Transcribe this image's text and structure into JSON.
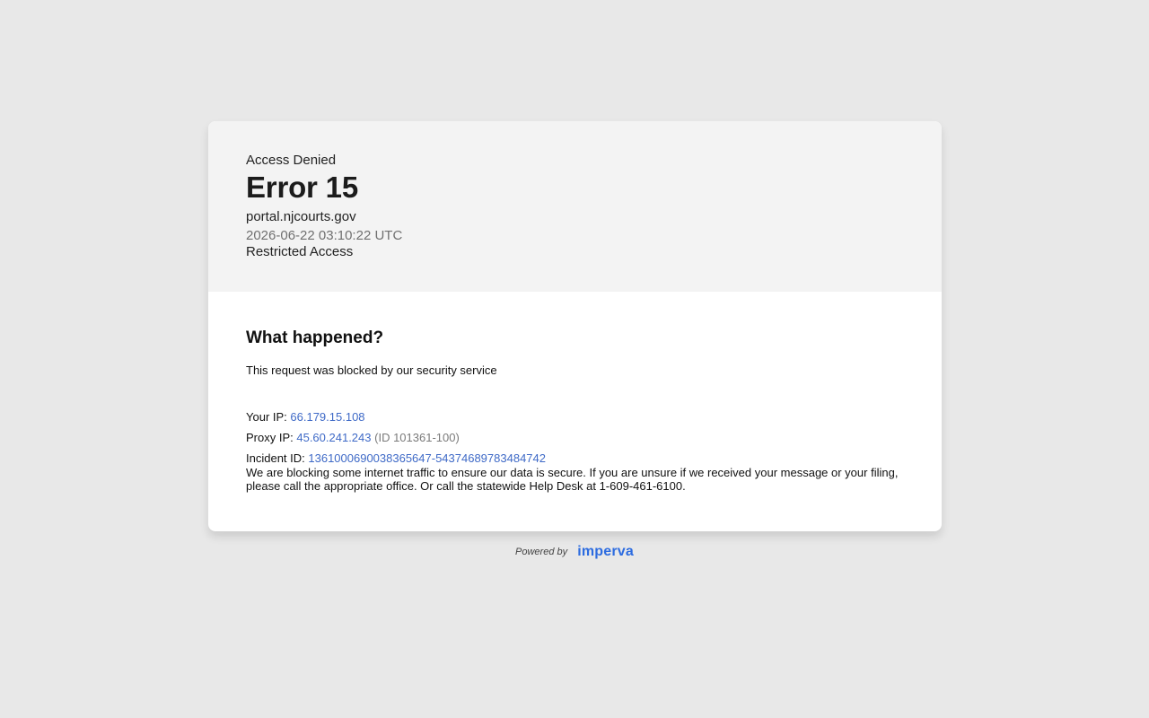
{
  "header": {
    "access_denied": "Access Denied",
    "error_title": "Error 15",
    "domain": "portal.njcourts.gov",
    "timestamp": "2026-06-22 03:10:22 UTC",
    "restricted": "Restricted Access"
  },
  "body": {
    "section_title": "What happened?",
    "blocked_message": "This request was blocked by our security service",
    "your_ip_label": "Your IP: ",
    "your_ip": "66.179.15.108",
    "proxy_ip_label": "Proxy IP: ",
    "proxy_ip": "45.60.241.243",
    "proxy_id": "(ID 101361-100)",
    "incident_label": "Incident ID: ",
    "incident_id": "1361000690038365647-54374689783484742",
    "notice": "We are blocking some internet traffic to ensure our data is secure. If you are unsure if we received your message or your filing, please call the appropriate office. Or call the statewide Help Desk at 1-609-461-6100."
  },
  "footer": {
    "powered_by": "Powered by",
    "brand": "imperva"
  },
  "colors": {
    "background": "#e8e8e8",
    "header_bg": "#f3f3f3",
    "link": "#3f6ac7",
    "brand": "#2d6ce0"
  }
}
